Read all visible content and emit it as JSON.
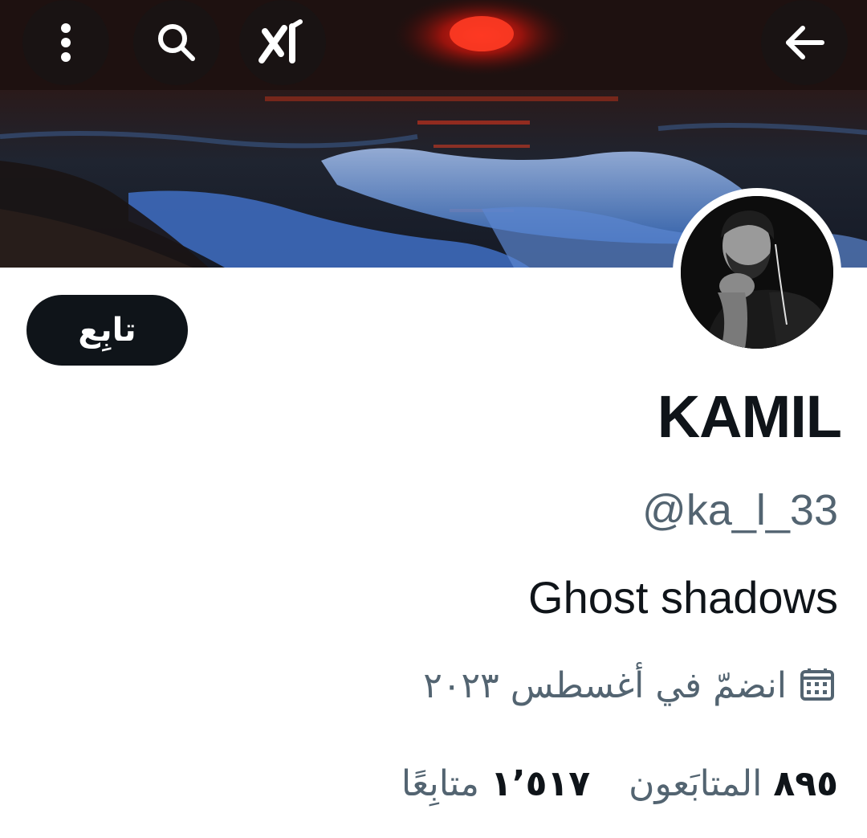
{
  "header": {
    "more_icon": "more-vertical-icon",
    "search_icon": "search-icon",
    "grok_icon": "grok-icon",
    "back_icon": "arrow-left-icon"
  },
  "profile": {
    "display_name": "KAMIL",
    "handle": "@ka_l_33",
    "bio": "Ghost shadows",
    "joined": "انضمّ في أغسطس ٢٠٢٣",
    "follow_label": "تابِع",
    "followers_count": "٨٩٥",
    "followers_label": "المتابَعون",
    "following_count": "١٬٥١٧",
    "following_label": "متابِعًا"
  },
  "colors": {
    "primary_text": "#0f1419",
    "secondary_text": "#536471",
    "button_bg": "#0f1419"
  }
}
